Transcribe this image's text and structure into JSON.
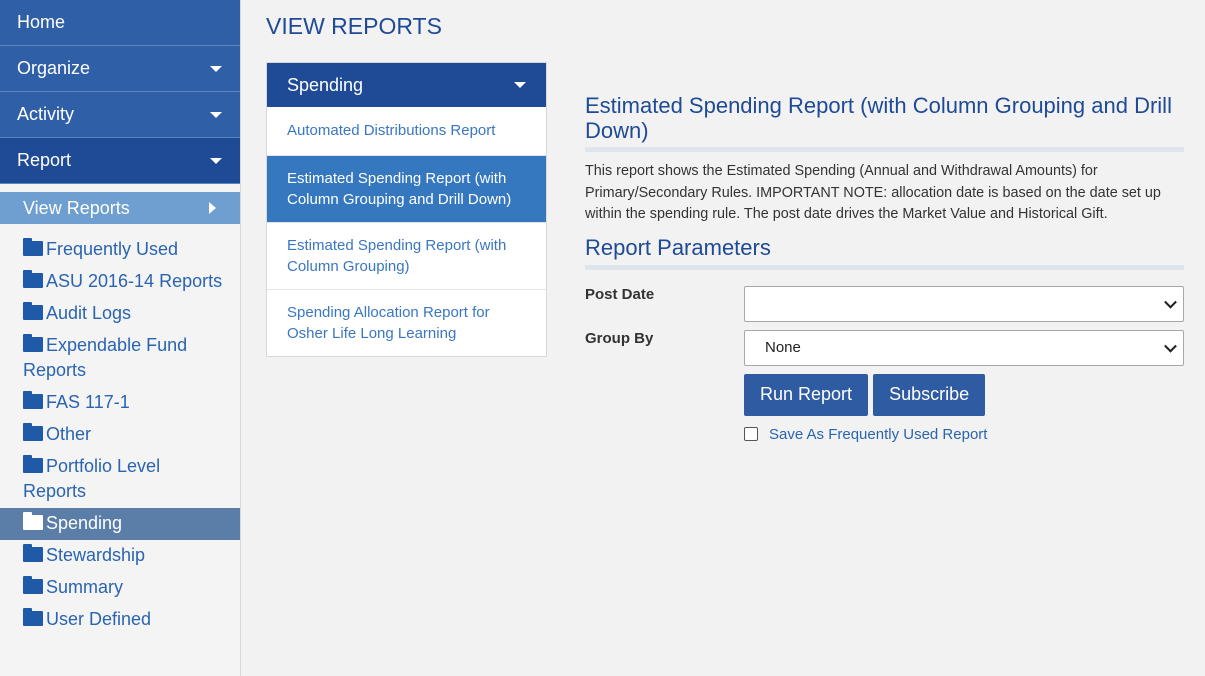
{
  "sidebar": {
    "nav": [
      {
        "label": "Home",
        "has_caret": false
      },
      {
        "label": "Organize",
        "has_caret": true
      },
      {
        "label": "Activity",
        "has_caret": true
      },
      {
        "label": "Report",
        "has_caret": true,
        "active": true
      }
    ],
    "sub_item": "View Reports",
    "folders": [
      "Frequently Used",
      "ASU 2016-14 Reports",
      "Audit Logs",
      "Expendable Fund Reports",
      "FAS 117-1",
      "Other",
      "Portfolio Level Reports",
      "Spending",
      "Stewardship",
      "Summary",
      "User Defined"
    ],
    "selected_folder": "Spending"
  },
  "main": {
    "page_title": "VIEW REPORTS",
    "panel": {
      "header": "Spending",
      "reports": [
        "Automated Distributions Report",
        "Estimated Spending Report (with Column Grouping and Drill Down)",
        "Estimated Spending Report (with Column Grouping)",
        "Spending Allocation Report for Osher Life Long Learning"
      ],
      "selected_index": 1
    },
    "detail": {
      "title": "Estimated Spending Report (with Column Grouping and Drill Down)",
      "description": "This report shows the Estimated Spending (Annual and Withdrawal Amounts) for Primary/Secondary Rules. IMPORTANT NOTE: allocation date is based on the date set up within the spending rule. The post date drives the Market Value and Historical Gift.",
      "params_title": "Report Parameters",
      "post_date_label": "Post Date",
      "post_date_value": "",
      "group_by_label": "Group By",
      "group_by_value": "None",
      "run_button": "Run Report",
      "subscribe_button": "Subscribe",
      "save_label": "Save As Frequently Used Report"
    }
  },
  "icons": {
    "folder": "folder-icon",
    "caret_down": "caret-down-icon",
    "caret_right": "caret-right-icon",
    "chevron_down": "chevron-down-icon"
  },
  "colors": {
    "nav_bg": "#2f5fa7",
    "nav_active_bg": "#1f4b96",
    "sub_item_bg": "#6e9fd0",
    "link": "#2a64b0",
    "selected_report_bg": "#3578c0",
    "button_bg": "#2f5ba3"
  }
}
